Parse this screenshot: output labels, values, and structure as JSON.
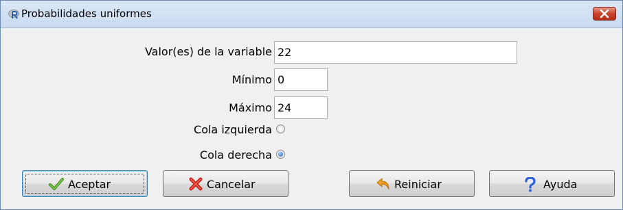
{
  "window": {
    "title": "Probabilidades uniformes",
    "app_icon": "r-logo-icon",
    "close_icon": "close-icon"
  },
  "form": {
    "values": {
      "label": "Valor(es) de la variable",
      "value": "22"
    },
    "minimum": {
      "label": "Mínimo",
      "value": "0"
    },
    "maximum": {
      "label": "Máximo",
      "value": "24"
    },
    "tail_options": [
      {
        "label": "Cola izquierda",
        "selected": false
      },
      {
        "label": "Cola derecha",
        "selected": true
      }
    ]
  },
  "buttons": {
    "accept": {
      "label": "Aceptar",
      "icon": "checkmark-icon"
    },
    "cancel": {
      "label": "Cancelar",
      "icon": "red-x-icon"
    },
    "reset": {
      "label": "Reiniciar",
      "icon": "undo-arrow-icon"
    },
    "help": {
      "label": "Ayuda",
      "icon": "question-mark-icon"
    }
  }
}
